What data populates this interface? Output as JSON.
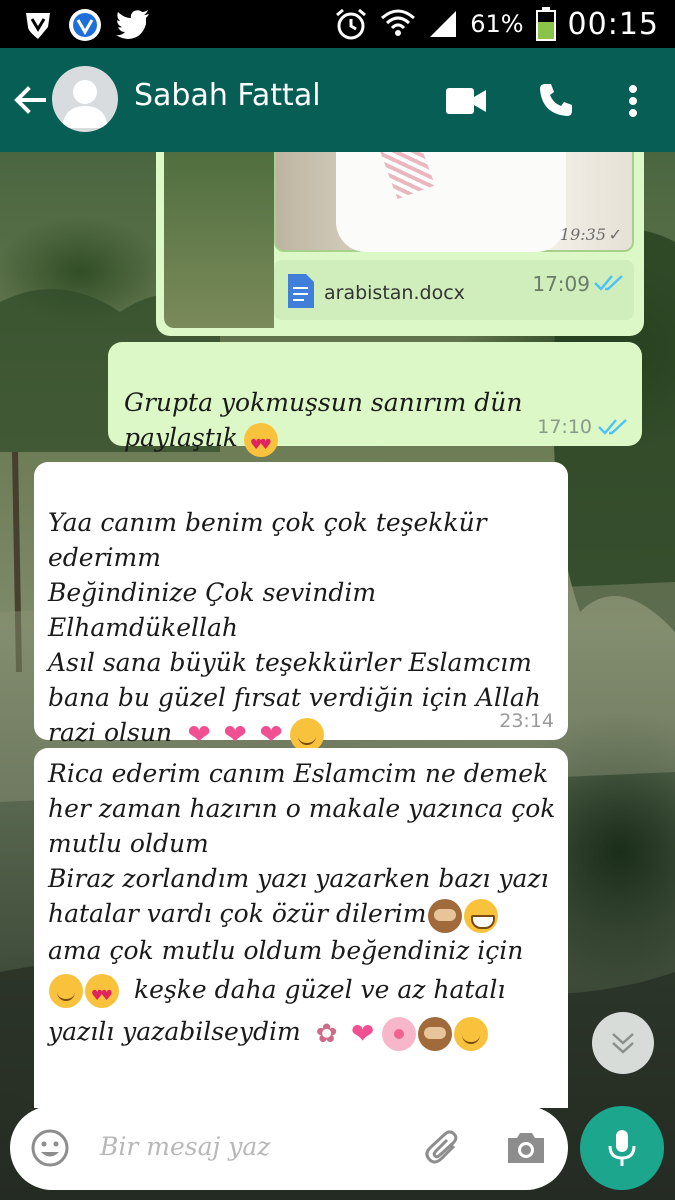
{
  "status_bar": {
    "battery": "61%",
    "time": "00:15"
  },
  "header": {
    "contact_name": "Sabah Fattal"
  },
  "attachment": {
    "image_time": "19:35",
    "file_name": "arabistan.docx",
    "time": "17:09"
  },
  "messages": [
    {
      "direction": "outgoing",
      "text": "Grupta yokmuşsun sanırım dün\npaylaştık",
      "time": "17:10"
    },
    {
      "direction": "incoming",
      "text": "Yaa canım benim çok çok teşekkür\nederimm\nBeğindinize Çok sevindim\nElhamdükellah\nAsıl sana büyük teşekkürler Eslamcım\nbana bu güzel fırsat verdiğin için   Allah\nrazi olsun",
      "time": "23:14"
    },
    {
      "direction": "incoming",
      "line1": "Rica ederim canım Eslamcim ne demek",
      "line2": "her zaman hazırın o makale yazınca çok",
      "line3": "mutlu oldum",
      "line4": "Biraz zorlandım yazı yazarken bazı yazı",
      "line5": "hatalar vardı çok özür dilerim",
      "line6": "ama çok mutlu oldum beğendiniz için",
      "line7": "keşke daha güzel ve az hatalı",
      "line8": "yazılı yazabilseydim"
    }
  ],
  "composer": {
    "placeholder": "Bir mesaj yaz"
  },
  "colors": {
    "header": "#075e54",
    "outgoing_bubble": "#dcf8c6",
    "incoming_bubble": "#ffffff",
    "mic_button": "#1da68e",
    "read_ticks": "#4fc3f7"
  },
  "icons": [
    "shield-icon",
    "vpn-icon",
    "twitter-icon",
    "alarm-icon",
    "wifi-icon",
    "signal-icon",
    "battery-icon",
    "back-arrow-icon",
    "video-call-icon",
    "phone-icon",
    "more-vert-icon",
    "document-icon",
    "double-check-icon",
    "chevron-down-icon",
    "emoji-icon",
    "attach-icon",
    "camera-icon",
    "mic-icon"
  ]
}
